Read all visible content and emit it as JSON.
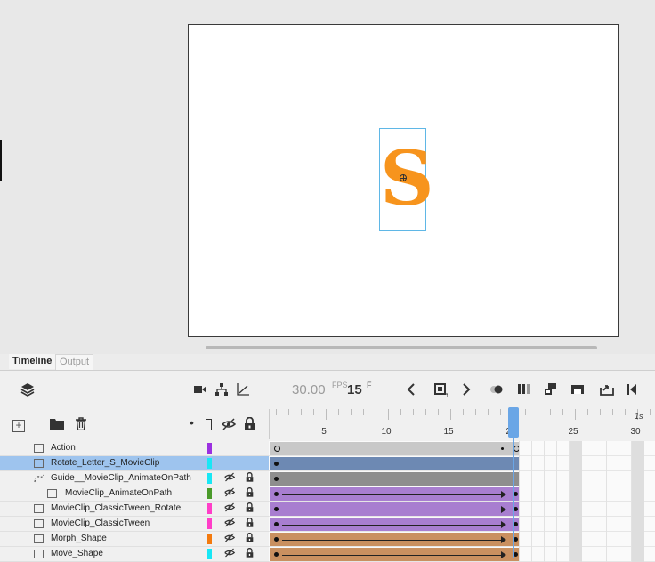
{
  "stage": {
    "letter": "S",
    "letter_color": "#f7941d"
  },
  "panel": {
    "tabs": [
      {
        "label": "Timeline"
      },
      {
        "label": "Output"
      }
    ],
    "toolbar": {
      "fps_value": "30.00",
      "fps_unit": "FPS",
      "frame_value": "15",
      "frame_unit": "F",
      "icons": [
        "layers-icon",
        "camera-icon",
        "layer-depth-icon",
        "graph-icon",
        "prev-frame-icon",
        "insert-keyframe-icon",
        "next-frame-icon",
        "onion-skin-icon",
        "edit-multiple-frames-icon",
        "loop-icon",
        "center-frame-icon",
        "export-icon",
        "step-back-icon"
      ]
    },
    "ruler": {
      "labels": [
        "5",
        "10",
        "15",
        "20",
        "25",
        "30"
      ],
      "seconds_label": "1s"
    }
  },
  "layers": [
    {
      "name": "Action",
      "color": "#9b30e0",
      "selected": false,
      "sub": false,
      "show_toggles": false,
      "tween": "none",
      "span_color": "#c8c8c8"
    },
    {
      "name": "Rotate_Letter_S_MovieClip",
      "color": "#18e7f5",
      "selected": true,
      "sub": false,
      "show_toggles": false,
      "tween": "none",
      "span_color": "#6d89b3"
    },
    {
      "name": "Guide__MovieClip_AnimateOnPath",
      "color": "#18e7f5",
      "selected": false,
      "sub": false,
      "guide": true,
      "show_toggles": true,
      "tween": "none",
      "span_color": "#8e8e8e"
    },
    {
      "name": "MovieClip_AnimateOnPath",
      "color": "#4a9a2a",
      "selected": false,
      "sub": true,
      "show_toggles": true,
      "tween": "classic",
      "span_color": "#a87ed0"
    },
    {
      "name": "MovieClip_ClassicTween_Rotate",
      "color": "#ff3ec8",
      "selected": false,
      "sub": false,
      "show_toggles": true,
      "tween": "classic",
      "span_color": "#a87ed0"
    },
    {
      "name": "MovieClip_ClassicTween",
      "color": "#ff3ec8",
      "selected": false,
      "sub": false,
      "show_toggles": true,
      "tween": "classic",
      "span_color": "#a87ed0"
    },
    {
      "name": "Morph_Shape",
      "color": "#f47a0e",
      "selected": false,
      "sub": false,
      "show_toggles": true,
      "tween": "shape",
      "span_color": "#c99060"
    },
    {
      "name": "Move_Shape",
      "color": "#18e7f5",
      "selected": false,
      "sub": false,
      "show_toggles": true,
      "tween": "shape",
      "span_color": "#c99060"
    }
  ]
}
